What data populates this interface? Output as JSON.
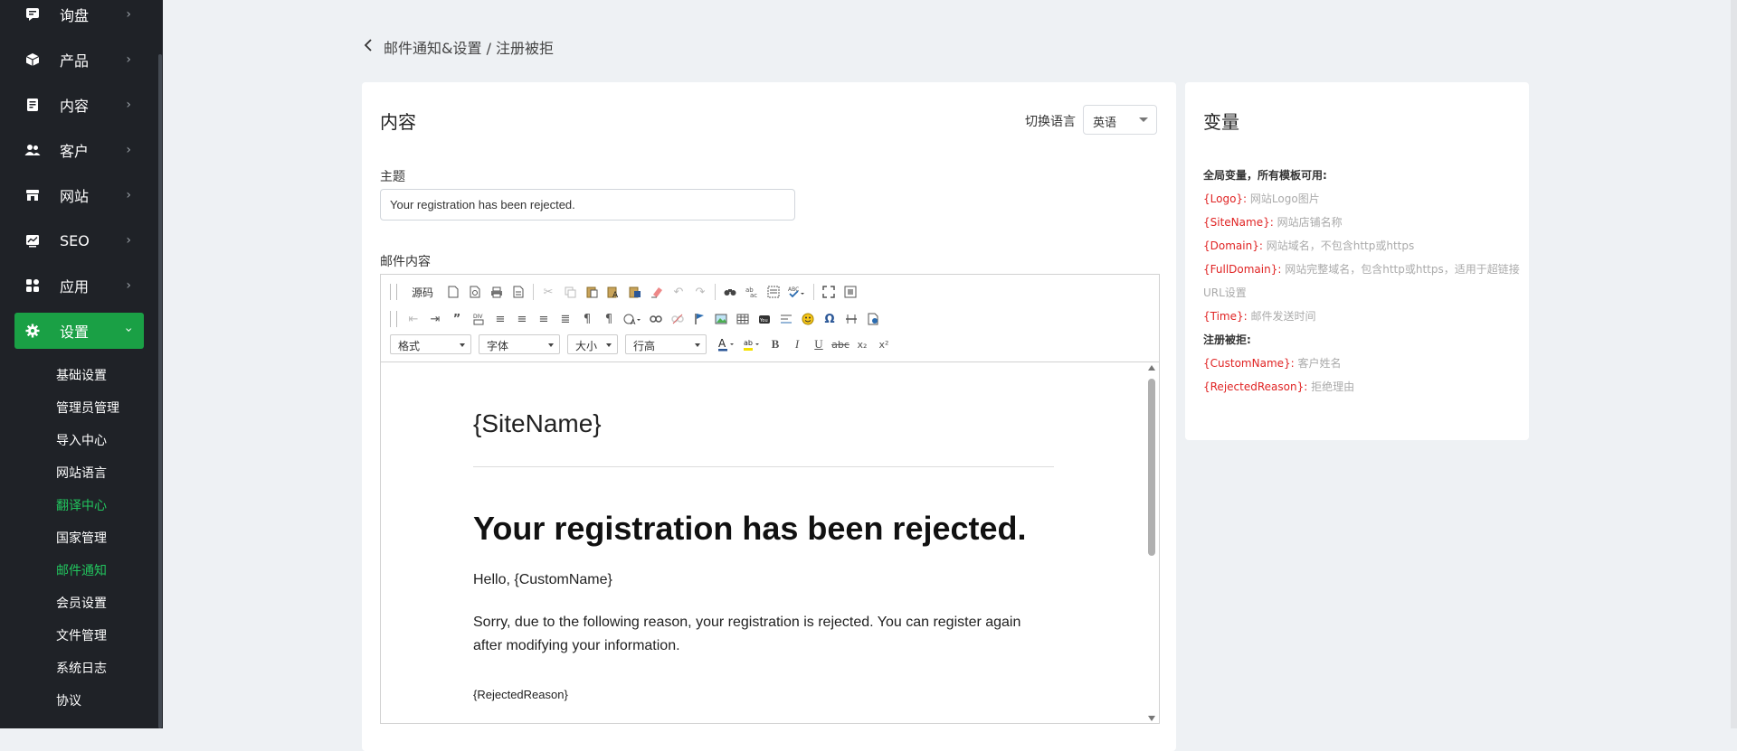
{
  "sidebar": {
    "items": [
      {
        "label": "询盘",
        "icon": "message-icon"
      },
      {
        "label": "产品",
        "icon": "box-icon"
      },
      {
        "label": "内容",
        "icon": "document-icon"
      },
      {
        "label": "客户",
        "icon": "users-icon"
      },
      {
        "label": "网站",
        "icon": "store-icon"
      },
      {
        "label": "SEO",
        "icon": "chart-icon"
      },
      {
        "label": "应用",
        "icon": "apps-icon"
      },
      {
        "label": "设置",
        "icon": "gear-icon"
      }
    ],
    "sub_items": [
      "基础设置",
      "管理员管理",
      "导入中心",
      "网站语言",
      "翻译中心",
      "国家管理",
      "邮件通知",
      "会员设置",
      "文件管理",
      "系统日志",
      "协议"
    ]
  },
  "breadcrumb": {
    "text": "邮件通知&设置 / 注册被拒"
  },
  "panel": {
    "title": "内容",
    "lang_label": "切换语言",
    "lang_value": "英语",
    "subject_label": "主题",
    "subject_value": "Your registration has been rejected.",
    "body_label": "邮件内容"
  },
  "editor": {
    "source_label": "源码",
    "combos": [
      "格式",
      "字体",
      "大小",
      "行高"
    ],
    "content": {
      "site": "{SiteName}",
      "heading": "Your registration has been rejected.",
      "hello": "Hello, {CustomName}",
      "para": "Sorry, due to the following reason, your registration is rejected. You can register again after modifying your information.",
      "reason": "{RejectedReason}"
    }
  },
  "variables": {
    "title": "变量",
    "global_head": "全局变量，所有模板可用:",
    "global": [
      {
        "key": "{Logo}:",
        "desc": "网站Logo图片"
      },
      {
        "key": "{SiteName}:",
        "desc": "网站店铺名称"
      },
      {
        "key": "{Domain}:",
        "desc": "网站域名，不包含http或https"
      },
      {
        "key": "{FullDomain}:",
        "desc": "网站完整域名，包含http或https，适用于超链接"
      },
      {
        "key": "",
        "desc": "URL设置"
      },
      {
        "key": "{Time}:",
        "desc": "邮件发送时间"
      }
    ],
    "local_head": "注册被拒:",
    "local": [
      {
        "key": "{CustomName}:",
        "desc": "客户姓名"
      },
      {
        "key": "{RejectedReason}:",
        "desc": "拒绝理由"
      }
    ]
  },
  "colors": {
    "sidebar_bg": "#1f2227",
    "active_green": "#1aa045",
    "var_key": "#e02424"
  }
}
